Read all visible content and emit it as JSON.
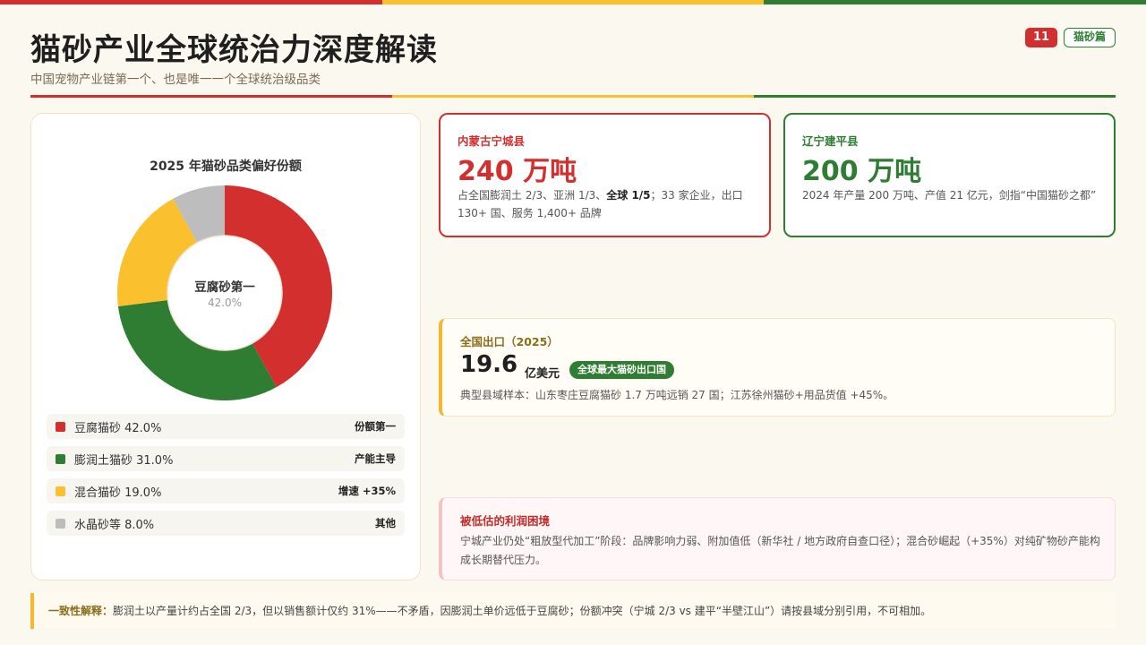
{
  "colors": {
    "red": "#d32f2f",
    "yellow": "#fbc02d",
    "green": "#2e7d32",
    "grey": "#bdbdbd"
  },
  "header": {
    "title": "猫砂产业全球统治力深度解读",
    "subtitle": "中国宠物产业链第一个、也是唯一一个全球统治级品类",
    "page_number": "11",
    "section_tag": "猫砂篇"
  },
  "chart_data": {
    "type": "pie",
    "title": "2025 年猫砂品类偏好份额",
    "center_label": "豆腐砂第一",
    "center_value": "42.0%",
    "categories": [
      "豆腐猫砂",
      "膨润土猫砂",
      "混合猫砂",
      "水晶砂等"
    ],
    "values": [
      42.0,
      31.0,
      19.0,
      8.0
    ],
    "colors": [
      "#d32f2f",
      "#2e7d32",
      "#fbc02d",
      "#bdbdbd"
    ]
  },
  "legend": [
    {
      "label": "豆腐猫砂 42.0%",
      "note": "份额第一"
    },
    {
      "label": "膨润土猫砂 31.0%",
      "note": "产能主导"
    },
    {
      "label": "混合猫砂 19.0%",
      "note": "增速 +35%"
    },
    {
      "label": "水晶砂等 8.0%",
      "note": "其他"
    }
  ],
  "stats": {
    "chengxian": {
      "region": "内蒙古宁城县",
      "value": "240 万吨",
      "desc_pre": "占全国膨润土 2/3、亚洲 1/3、",
      "desc_bold": "全球 1/5",
      "desc_post": "；33 家企业，出口 130+ 国、服务 1,400+ 品牌"
    },
    "jianping": {
      "region": "辽宁建平县",
      "value": "200 万吨",
      "desc": "2024 年产量 200 万吨、产值 21 亿元，剑指“中国猫砂之都”"
    }
  },
  "export": {
    "head": "全国出口（2025）",
    "value": "19.6",
    "unit": "亿美元",
    "badge": "全球最大猫砂出口国",
    "desc": "典型县域样本：山东枣庄豆腐猫砂 1.7 万吨远销 27 国；江苏徐州猫砂+用品货值 +45%。"
  },
  "profit": {
    "head": "被低估的利润困境",
    "desc": "宁城产业仍处“粗放型代加工”阶段：品牌影响力弱、附加值低（新华社 / 地方政府自查口径）；混合砂崛起（+35%）对纯矿物砂产能构成长期替代压力。"
  },
  "footer": {
    "label": "一致性解释：",
    "text": "膨润土以产量计约占全国 2/3，但以销售额计仅约 31%——不矛盾，因膨润土单价远低于豆腐砂；份额冲突（宁城 2/3 vs 建平“半壁江山”）请按县域分别引用，不可相加。"
  }
}
